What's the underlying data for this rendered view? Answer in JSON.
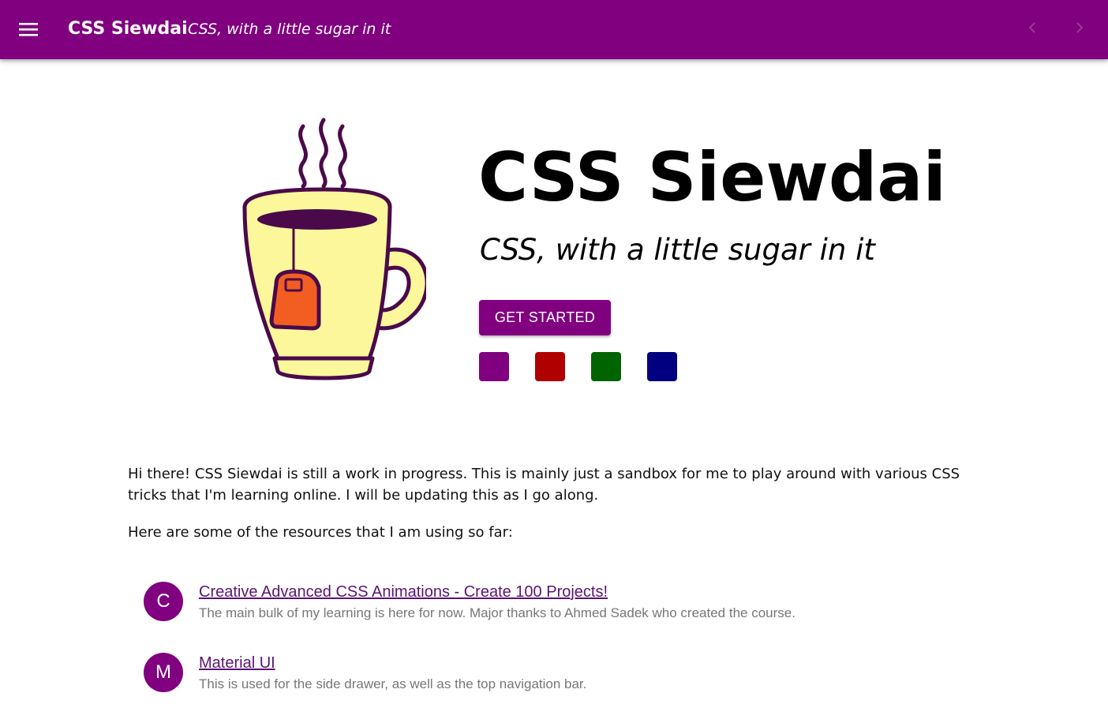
{
  "appbar": {
    "title": "CSS Siewdai",
    "subtitle": "CSS, with a little sugar in it",
    "menu_icon": "menu-icon",
    "prev_icon": "chevron-left-icon",
    "next_icon": "chevron-right-icon",
    "background_color": "#800080"
  },
  "hero": {
    "title": "CSS Siewdai",
    "subtitle": "CSS, with a little sugar in it",
    "button_label": "GET STARTED",
    "illustration": "tea-mug-icon",
    "swatches": [
      {
        "name": "purple",
        "color": "#800080"
      },
      {
        "name": "red",
        "color": "#b00000"
      },
      {
        "name": "green",
        "color": "#006400"
      },
      {
        "name": "navy",
        "color": "#000080"
      }
    ]
  },
  "content": {
    "intro": "Hi there! CSS Siewdai is still a work in progress. This is mainly just a sandbox for me to play around with various CSS tricks that I'm learning online. I will be updating this as I go along.",
    "resources_heading": "Here are some of the resources that I am using so far:",
    "resources": [
      {
        "avatar": "C",
        "title": "Creative Advanced CSS Animations - Create 100 Projects!",
        "description": "The main bulk of my learning is here for now. Major thanks to Ahmed Sadek who created the course."
      },
      {
        "avatar": "M",
        "title": "Material UI",
        "description": "This is used for the side drawer, as well as the top navigation bar."
      }
    ]
  }
}
